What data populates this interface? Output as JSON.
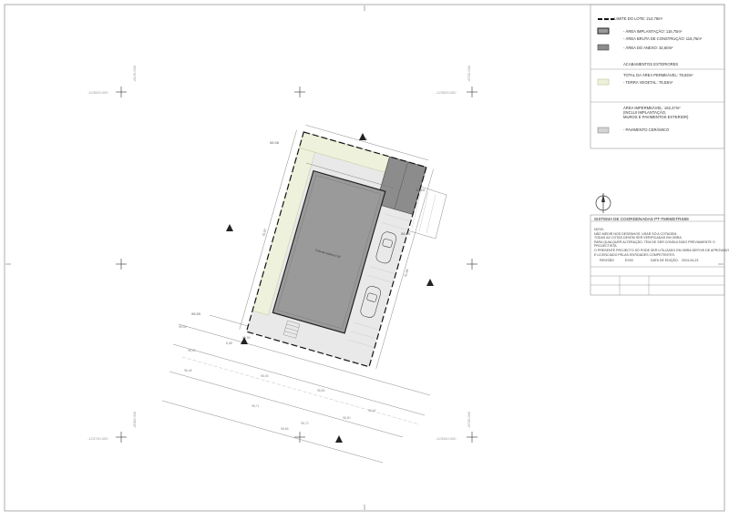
{
  "legend": {
    "limite_lote": "LIMITE DO LOTE: 214,79m²",
    "area_implantacao": "- ÁREA IMPLANTAÇÃO: 116,75m²",
    "area_bruta": "- ÁREA BRUTA DE CONSTRUÇÃO: 116,75m²",
    "area_anexo": "- ÁREA DO ANEXO: 32,60m²",
    "acabamentos_title": "ACABAMENTOS EXTERIORES",
    "total_permeavel": "TOTAL DA ÁREA PERMEÁVEL: 78,63m²",
    "terra_vegetal": "- TERRA VEGETAL: 78,63m²",
    "area_impermeavel": "ÁREA IMPERMEÁVEL: 162,47m²",
    "inclui_implantacao": "(INCLUI IMPLANTAÇÃO,",
    "muros": "MUROS E PAVIMENTOS EXTERIOR)",
    "pavimento_ceramico": "- PAVIMENTO CERÂMICO",
    "colors": {
      "implantacao": "#9a9a9a",
      "anexo": "#8c8c8c",
      "terra": "#eef2dc",
      "ceramico": "#d4d4d4"
    }
  },
  "title_block": {
    "system": "SISTEMA DE COORDENADAS PT-TM06/ETRS89",
    "notes_title": "NOTA:",
    "notes": [
      "NÃO MEDIR NOS DESENHOS. USAR SÓ A COTAGEM.",
      "TODAS AS COTAS DEVEM SER VERIFICADAS EM OBRA.",
      "PARA QUALQUER ALTERAÇÃO, TEM DE SER CONSULTADO PREVIAMENTE O",
      "PROJECTISTA.",
      "O PRESENTE PROJECTO SÓ PODE SER UTILIZADO EM OBRA DEPOIS DE APROVADO",
      "E LICENCIADO PELAS ENTIDADES COMPETENTES."
    ],
    "revisao_label": "REVISÃO",
    "data_label": "DATA",
    "revisao_value": "EX00",
    "data_edicao_label": "DATA DE EDIÇÃO:",
    "data_edicao_value": "2024-04-23"
  },
  "plan": {
    "building_label": "Cota de soleira 0.00",
    "coord_labels": {
      "x_top_left": "-123000.000",
      "x_top_right": "-123500.000",
      "x_bot_left": "-123740.000",
      "x_bot_right": "-123340.000",
      "y_left_top": "-8120.000",
      "y_right_top": "-8700.000",
      "y_left_bot": "-8080.000",
      "y_right_bot": "-8700.000"
    },
    "dims": {
      "top": "9,90",
      "top_left": "58,58",
      "left_side": "21,97",
      "right_side": "21,64",
      "right_top": "58,53",
      "lower_left": "98,55",
      "corner_bl": "0,40"
    },
    "spot_levels": [
      "98,56",
      "98,52",
      "98,48",
      "98,45",
      "98,60",
      "98,71",
      "98,62",
      "98,73",
      "98,66",
      "98,58",
      "98,50"
    ]
  }
}
